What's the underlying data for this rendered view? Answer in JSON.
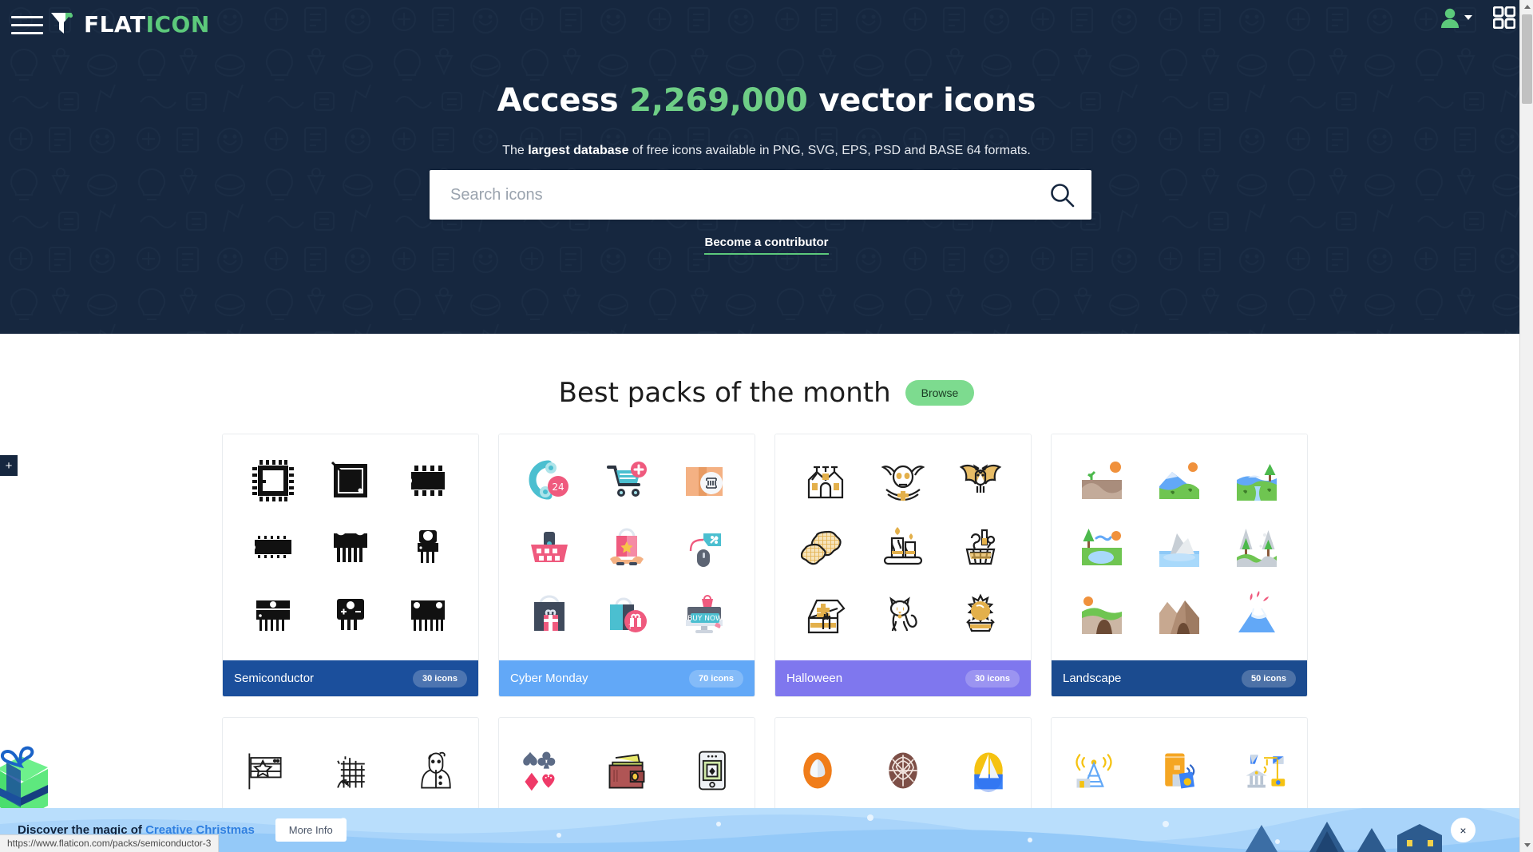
{
  "brand": {
    "name_white": "FLAT",
    "name_green": "ICON",
    "accent_green": "#5cc97b",
    "hero_bg": "#16273f"
  },
  "topbar": {
    "menu_label": "menu",
    "user_label": "account",
    "apps_label": "apps"
  },
  "hero": {
    "title_prefix": "Access ",
    "title_number": "2,269,000",
    "title_suffix": " vector icons",
    "subtitle_before": "The ",
    "subtitle_bold": "largest database",
    "subtitle_after": " of free icons available in PNG, SVG, EPS, PSD and BASE 64 formats.",
    "contributor_link": "Become a contributor"
  },
  "search": {
    "placeholder": "Search icons",
    "value": "",
    "button_label": "search"
  },
  "section": {
    "title": "Best packs of the month",
    "browse_label": "Browse"
  },
  "packs": [
    {
      "name": "Semiconductor",
      "count": "30 icons",
      "color": "#1b4f9c",
      "style": "glyph-black"
    },
    {
      "name": "Cyber Monday",
      "count": "70 icons",
      "color": "#62a8f7",
      "style": "flat-color"
    },
    {
      "name": "Halloween",
      "count": "30 icons",
      "color": "#7f77ee",
      "style": "outline-gold"
    },
    {
      "name": "Landscape",
      "count": "50 icons",
      "color": "#1b4b8f",
      "style": "flat-scene"
    }
  ],
  "packs_row2": [
    {
      "style": "outline-black"
    },
    {
      "style": "casino"
    },
    {
      "style": "round-badge"
    },
    {
      "style": "tech-blue"
    }
  ],
  "banner": {
    "text_before": "Discover the magic of ",
    "text_link": "Creative Christmas",
    "more_info_label": "More Info",
    "close_label": "×",
    "bg_color": "#b9defc"
  },
  "statusbar": {
    "url": "https://www.flaticon.com/packs/semiconductor-3"
  },
  "left_widgets": {
    "plus_label": "+",
    "gift_label": "gift"
  }
}
